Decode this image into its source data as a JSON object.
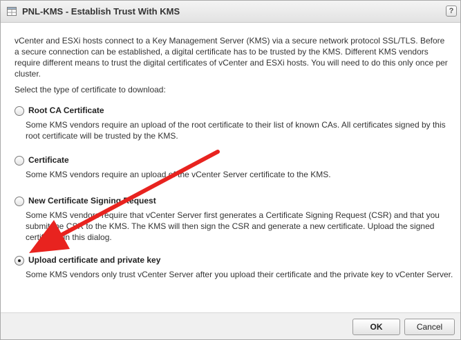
{
  "dialog": {
    "title": "PNL-KMS - Establish Trust With KMS",
    "help_symbol": "?"
  },
  "intro": "vCenter and ESXi hosts connect to a Key Management Server (KMS) via a secure network protocol SSL/TLS. Before a secure connection can be established, a digital certificate has to be trusted by the KMS. Different KMS vendors require different means to trust the digital certificates of vCenter and ESXi hosts. You will need to do this only once per cluster.",
  "select_label": "Select the type of certificate to download:",
  "options": [
    {
      "label": "Root CA Certificate",
      "description": "Some KMS vendors require an upload of the root certificate to their list of known CAs. All certificates signed by this root certificate will be trusted by the KMS.",
      "selected": false
    },
    {
      "label": "Certificate",
      "description": "Some KMS vendors require an upload of the vCenter Server certificate to the KMS.",
      "selected": false
    },
    {
      "label": "New Certificate Signing Request",
      "description": "Some KMS vendors require that vCenter Server first generates a Certificate Signing Request (CSR) and that you submit the CSR to the KMS. The KMS will then sign the CSR and generate a new certificate. Upload the signed certificate in this dialog.",
      "selected": false
    },
    {
      "label": "Upload certificate and private key",
      "description": "Some KMS vendors only trust vCenter Server after you upload their certificate and the private key to vCenter Server.",
      "selected": true
    }
  ],
  "footer": {
    "ok_label": "OK",
    "cancel_label": "Cancel"
  },
  "annotation": {
    "arrow_color": "#e8231f"
  },
  "icons": {
    "title": "dialog-window-icon",
    "help": "help-icon",
    "annotation": "red-arrow-icon"
  }
}
